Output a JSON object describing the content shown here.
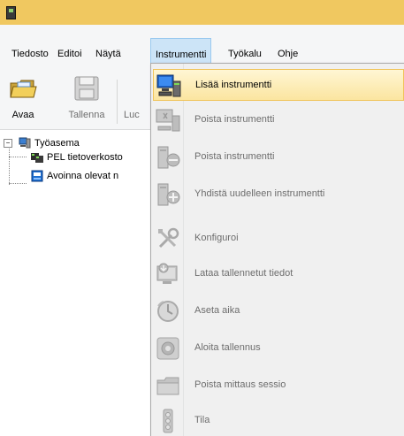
{
  "menubar": {
    "items": [
      "Tiedosto",
      "Editoi",
      "Näytä",
      "Instrumentti",
      "Työkalu",
      "Ohje"
    ]
  },
  "toolbar": {
    "open_label": "Avaa",
    "save_label": "Tallenna",
    "partial_label": "Luc"
  },
  "tree": {
    "root": "Työasema",
    "child1": "PEL tietoverkosto",
    "child2": "Avoinna olevat n"
  },
  "instrument_menu": {
    "items": [
      {
        "label": "Lisää instrumentti",
        "icon": "add-instrument-icon",
        "enabled": true
      },
      {
        "label": "Poista instrumentti",
        "icon": "remove-instrument-icon",
        "enabled": false
      },
      {
        "label": "Poista instrumentti",
        "icon": "disconnect-instrument-icon",
        "enabled": false
      },
      {
        "label": "Yhdistä uudelleen instrumentti",
        "icon": "reconnect-instrument-icon",
        "enabled": false
      },
      {
        "label": "Konfiguroi",
        "icon": "tools-icon",
        "enabled": false
      },
      {
        "label": "Lataa tallennetut tiedot",
        "icon": "download-data-icon",
        "enabled": false
      },
      {
        "label": "Aseta aika",
        "icon": "clock-icon",
        "enabled": false
      },
      {
        "label": "Aloita tallennus",
        "icon": "record-icon",
        "enabled": false
      },
      {
        "label": "Poista mittaus sessio",
        "icon": "folder-icon",
        "enabled": false
      },
      {
        "label": "Tila",
        "icon": "status-icon",
        "enabled": false
      }
    ]
  },
  "colors": {
    "titlebar": "#f0c860",
    "menu_active": "#cce4f7",
    "highlight": "#fbe5a0"
  }
}
